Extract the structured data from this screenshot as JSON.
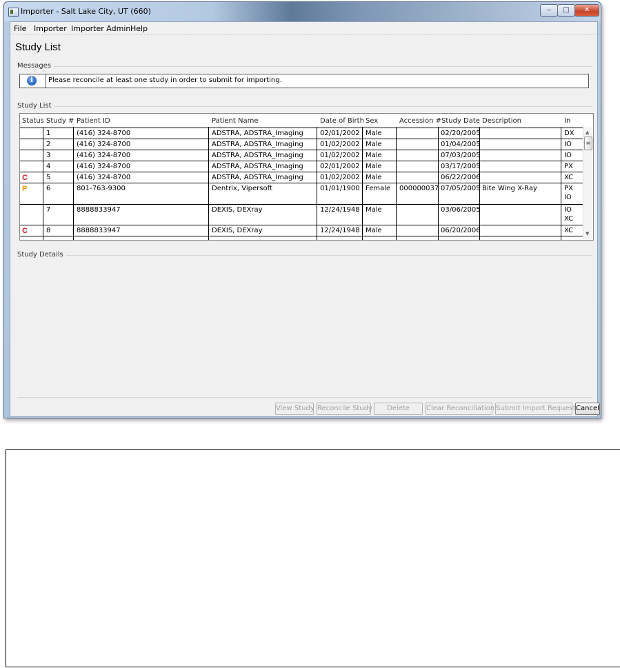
{
  "window": {
    "title": "Importer - Salt Lake City, UT (660)",
    "min_label": "‒",
    "max_label": "□",
    "close_label": "✕"
  },
  "menu": [
    "File",
    "Importer",
    "Importer Admin",
    "Help"
  ],
  "page_title": "Study List",
  "messages": {
    "label": "Messages",
    "icon": "info-icon",
    "text": "Please reconcile at least one study in order to submit for importing."
  },
  "study_list": {
    "label": "Study List",
    "columns": [
      "Status",
      "Study #",
      "Patient ID",
      "Patient Name",
      "Date of Birth",
      "Sex",
      "Accession #",
      "Study Date",
      "Description",
      "In"
    ],
    "rows": [
      {
        "status": "",
        "study": "1",
        "patient_id": "(416) 324-8700",
        "name": "ADSTRA, ADSTRA_Imaging",
        "dob": "02/01/2002",
        "sex": "Male",
        "accession": "",
        "date": "02/20/2005",
        "description": "",
        "in": "DX",
        "in2": ""
      },
      {
        "status": "",
        "study": "2",
        "patient_id": "(416) 324-8700",
        "name": "ADSTRA, ADSTRA_Imaging",
        "dob": "01/02/2002",
        "sex": "Male",
        "accession": "",
        "date": "01/04/2005",
        "description": "",
        "in": "IO",
        "in2": ""
      },
      {
        "status": "",
        "study": "3",
        "patient_id": "(416) 324-8700",
        "name": "ADSTRA, ADSTRA_Imaging",
        "dob": "01/02/2002",
        "sex": "Male",
        "accession": "",
        "date": "07/03/2005",
        "description": "",
        "in": "IO",
        "in2": ""
      },
      {
        "status": "",
        "study": "4",
        "patient_id": "(416) 324-8700",
        "name": "ADSTRA, ADSTRA_Imaging",
        "dob": "02/01/2002",
        "sex": "Male",
        "accession": "",
        "date": "03/17/2005",
        "description": "",
        "in": "PX",
        "in2": ""
      },
      {
        "status": "C",
        "study": "5",
        "patient_id": "(416) 324-8700",
        "name": "ADSTRA, ADSTRA_Imaging",
        "dob": "01/02/2002",
        "sex": "Male",
        "accession": "",
        "date": "06/22/2006",
        "description": "",
        "in": "XC",
        "in2": ""
      },
      {
        "status": "P",
        "study": "6",
        "patient_id": "801-763-9300",
        "name": "Dentrix, Vipersoft",
        "dob": "01/01/1900",
        "sex": "Female",
        "accession": "000000037",
        "date": "07/05/2005",
        "description": "Bite Wing X-Ray",
        "in": "PX",
        "in2": "IO"
      },
      {
        "status": "",
        "study": "7",
        "patient_id": "8888833947",
        "name": "DEXIS, DEXray",
        "dob": "12/24/1948",
        "sex": "Male",
        "accession": "",
        "date": "03/06/2005",
        "description": "",
        "in": "IO",
        "in2": "XC"
      },
      {
        "status": "C",
        "study": "8",
        "patient_id": "8888833947",
        "name": "DEXIS, DEXray",
        "dob": "12/24/1948",
        "sex": "Male",
        "accession": "",
        "date": "06/20/2006",
        "description": "",
        "in": "XC",
        "in2": ""
      }
    ],
    "status_colors": {
      "C": "#d01818",
      "P": "#e8a000"
    }
  },
  "study_details": {
    "label": "Study Details"
  },
  "buttons": {
    "view_study": "View Study",
    "reconcile_study": "Reconcile Study",
    "delete": "Delete",
    "clear_reconciliation": "Clear Reconciliation",
    "submit_import_request": "Submit Import Request",
    "cancel": "Cancel"
  }
}
